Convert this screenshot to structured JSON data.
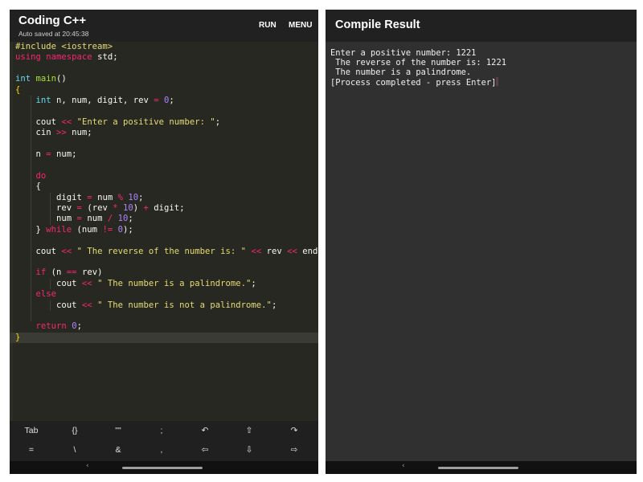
{
  "editor": {
    "title": "Coding C++",
    "autosave": "Auto saved at 20:45:38",
    "run_label": "RUN",
    "menu_label": "MENU"
  },
  "code_lines": [
    [
      [
        "#include ",
        "pre"
      ],
      [
        "<iostream>",
        "str"
      ]
    ],
    [
      [
        "using",
        "kw"
      ],
      [
        " ",
        "id"
      ],
      [
        "namespace",
        "kw"
      ],
      [
        " std;",
        "id"
      ]
    ],
    [],
    [
      [
        "int",
        "ty"
      ],
      [
        " ",
        "id"
      ],
      [
        "main",
        "fn"
      ],
      [
        "()",
        "id"
      ]
    ],
    [
      [
        "{",
        "brace"
      ]
    ],
    [
      [
        "    ",
        "id"
      ],
      [
        "int",
        "ty"
      ],
      [
        " n, num, digit, rev ",
        "id"
      ],
      [
        "=",
        "op"
      ],
      [
        " ",
        "id"
      ],
      [
        "0",
        "num"
      ],
      [
        ";",
        "id"
      ]
    ],
    [],
    [
      [
        "    cout ",
        "id"
      ],
      [
        "<<",
        "op"
      ],
      [
        " ",
        "id"
      ],
      [
        "\"Enter a positive number: \"",
        "str"
      ],
      [
        ";",
        "id"
      ]
    ],
    [
      [
        "    cin ",
        "id"
      ],
      [
        ">>",
        "op"
      ],
      [
        " num;",
        "id"
      ]
    ],
    [],
    [
      [
        "    n ",
        "id"
      ],
      [
        "=",
        "op"
      ],
      [
        " num;",
        "id"
      ]
    ],
    [],
    [
      [
        "    ",
        "id"
      ],
      [
        "do",
        "kw"
      ]
    ],
    [
      [
        "    {",
        "id"
      ]
    ],
    [
      [
        "        digit ",
        "id"
      ],
      [
        "=",
        "op"
      ],
      [
        " num ",
        "id"
      ],
      [
        "%",
        "op"
      ],
      [
        " ",
        "id"
      ],
      [
        "10",
        "num"
      ],
      [
        ";",
        "id"
      ]
    ],
    [
      [
        "        rev ",
        "id"
      ],
      [
        "=",
        "op"
      ],
      [
        " (rev ",
        "id"
      ],
      [
        "*",
        "op"
      ],
      [
        " ",
        "id"
      ],
      [
        "10",
        "num"
      ],
      [
        ") ",
        "id"
      ],
      [
        "+",
        "op"
      ],
      [
        " digit;",
        "id"
      ]
    ],
    [
      [
        "        num ",
        "id"
      ],
      [
        "=",
        "op"
      ],
      [
        " num ",
        "id"
      ],
      [
        "/",
        "op"
      ],
      [
        " ",
        "id"
      ],
      [
        "10",
        "num"
      ],
      [
        ";",
        "id"
      ]
    ],
    [
      [
        "    } ",
        "id"
      ],
      [
        "while",
        "kw"
      ],
      [
        " (num ",
        "id"
      ],
      [
        "!=",
        "op"
      ],
      [
        " ",
        "id"
      ],
      [
        "0",
        "num"
      ],
      [
        ");",
        "id"
      ]
    ],
    [],
    [
      [
        "    cout ",
        "id"
      ],
      [
        "<<",
        "op"
      ],
      [
        " ",
        "id"
      ],
      [
        "\" The reverse of the number is: \"",
        "str"
      ],
      [
        " ",
        "id"
      ],
      [
        "<<",
        "op"
      ],
      [
        " rev ",
        "id"
      ],
      [
        "<<",
        "op"
      ],
      [
        " endl;",
        "id"
      ]
    ],
    [],
    [
      [
        "    ",
        "id"
      ],
      [
        "if",
        "kw"
      ],
      [
        " (n ",
        "id"
      ],
      [
        "==",
        "op"
      ],
      [
        " rev)",
        "id"
      ]
    ],
    [
      [
        "        cout ",
        "id"
      ],
      [
        "<<",
        "op"
      ],
      [
        " ",
        "id"
      ],
      [
        "\" The number is a palindrome.\"",
        "str"
      ],
      [
        ";",
        "id"
      ]
    ],
    [
      [
        "    ",
        "id"
      ],
      [
        "else",
        "kw"
      ]
    ],
    [
      [
        "        cout ",
        "id"
      ],
      [
        "<<",
        "op"
      ],
      [
        " ",
        "id"
      ],
      [
        "\" The number is not a palindrome.\"",
        "str"
      ],
      [
        ";",
        "id"
      ]
    ],
    [],
    [
      [
        "    ",
        "id"
      ],
      [
        "return",
        "kw"
      ],
      [
        " ",
        "id"
      ],
      [
        "0",
        "num"
      ],
      [
        ";",
        "id"
      ]
    ],
    [
      [
        "}",
        "brace"
      ]
    ]
  ],
  "keyboard": {
    "row1": [
      "Tab",
      "{}",
      "\"\"",
      ";",
      "↶",
      "⇧",
      "↷"
    ],
    "row2": [
      "=",
      "\\",
      "&",
      ",",
      "⇦",
      "⇩",
      "⇨"
    ]
  },
  "result": {
    "title": "Compile Result",
    "lines": [
      "Enter a positive number: 1221",
      " The reverse of the number is: 1221",
      " The number is a palindrome.",
      "[Process completed - press Enter]"
    ]
  },
  "colors": {
    "editor_bg": "#272822",
    "header_bg": "#212121",
    "result_bg": "#303030",
    "keyword": "#f92672",
    "type": "#66d9ef",
    "function": "#a6e22e",
    "string": "#e6db74",
    "number": "#ae81ff"
  }
}
